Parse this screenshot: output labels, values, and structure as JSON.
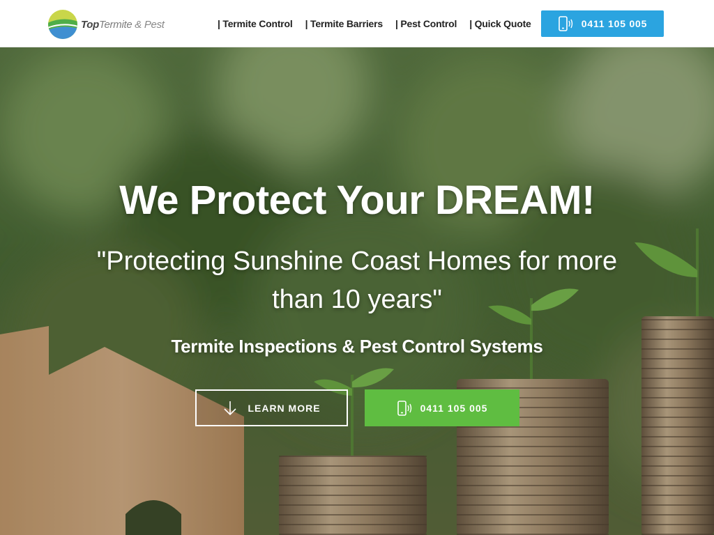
{
  "brand": {
    "name_strong": "Top",
    "name_rest": "Termite",
    "name_amp": " & Pest"
  },
  "nav": {
    "items": [
      {
        "label": "| Termite Control"
      },
      {
        "label": "| Termite Barriers"
      },
      {
        "label": "| Pest Control"
      },
      {
        "label": "| Quick Quote"
      }
    ]
  },
  "header_call": {
    "label": "0411 105 005",
    "color": "#2ba4e0"
  },
  "hero": {
    "title": "We Protect Your DREAM!",
    "quote": "\"Protecting Sunshine Coast Homes for more than 10 years\"",
    "subtitle": "Termite Inspections & Pest Control Systems",
    "learn_more_label": "LEARN MORE",
    "call_label": "0411 105 005",
    "call_color": "#5fbd41",
    "background": "blurred green foliage with wooden house cutout and stacks of coins with seedlings"
  },
  "icons": {
    "phone": "phone-ringing-icon",
    "arrow": "arrow-down-icon"
  }
}
